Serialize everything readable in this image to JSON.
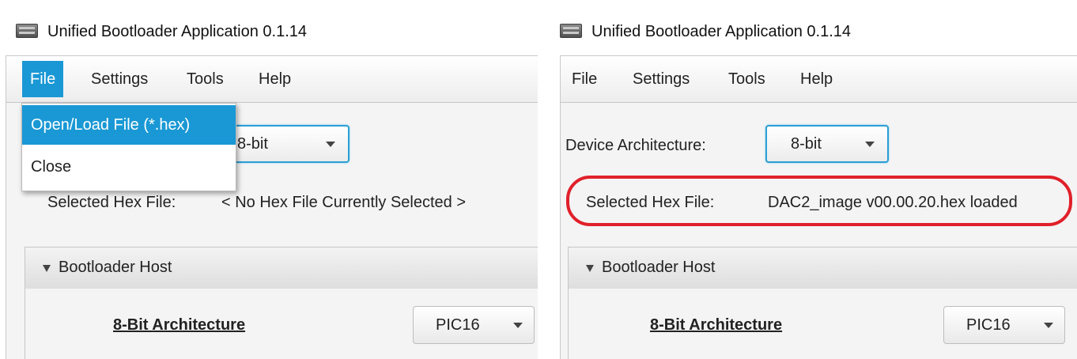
{
  "left": {
    "window_title": "Unified Bootloader Application 0.1.14",
    "menu": [
      "File",
      "Settings",
      "Tools",
      "Help"
    ],
    "file_menu": [
      "Open/Load File (*.hex)",
      "Close"
    ],
    "architecture_value": "8-bit",
    "hex_label": "Selected Hex File:",
    "hex_value": "< No Hex File Currently Selected >",
    "section_title": "Bootloader Host",
    "arch_title": "8-Bit Architecture",
    "device_value": "PIC16"
  },
  "right": {
    "window_title": "Unified Bootloader Application 0.1.14",
    "menu": [
      "File",
      "Settings",
      "Tools",
      "Help"
    ],
    "architecture_label": "Device Architecture:",
    "architecture_value": "8-bit",
    "hex_label": "Selected Hex File:",
    "hex_value": "DAC2_image v00.00.20.hex loaded",
    "section_title": "Bootloader Host",
    "arch_title": "8-Bit Architecture",
    "device_value": "PIC16"
  },
  "colors": {
    "menu_highlight": "#1a98d5",
    "focus_border": "#2a9fd6",
    "annotation_red": "#e0202a"
  }
}
